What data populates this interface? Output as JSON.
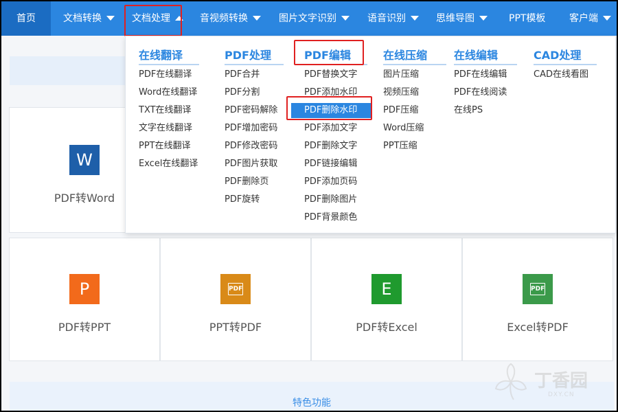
{
  "nav": {
    "items": [
      {
        "label": "首页"
      },
      {
        "label": "文档转换"
      },
      {
        "label": "文档处理"
      },
      {
        "label": "音视频转换"
      },
      {
        "label": "图片文字识别"
      },
      {
        "label": "语音识别"
      },
      {
        "label": "思维导图"
      },
      {
        "label": "PPT模板"
      },
      {
        "label": "客户端"
      }
    ]
  },
  "dropdown": {
    "columns": [
      {
        "title": "在线翻译",
        "items": [
          "PDF在线翻译",
          "Word在线翻译",
          "TXT在线翻译",
          "文字在线翻译",
          "PPT在线翻译",
          "Excel在线翻译"
        ]
      },
      {
        "title": "PDF处理",
        "items": [
          "PDF合并",
          "PDF分割",
          "PDF密码解除",
          "PDF增加密码",
          "PDF修改密码",
          "PDF图片获取",
          "PDF删除页",
          "PDF旋转"
        ]
      },
      {
        "title": "PDF编辑",
        "items": [
          "PDF替换文字",
          "PDF添加水印",
          "PDF删除水印",
          "PDF添加文字",
          "PDF删除文字",
          "PDF链接编辑",
          "PDF添加页码",
          "PDF删除图片",
          "PDF背景颜色"
        ]
      },
      {
        "title": "在线压缩",
        "items": [
          "图片压缩",
          "视频压缩",
          "PDF压缩",
          "Word压缩",
          "PPT压缩"
        ]
      },
      {
        "title": "在线编辑",
        "items": [
          "PDF在线编辑",
          "PDF在线阅读",
          "在线PS"
        ]
      },
      {
        "title": "CAD处理",
        "items": [
          "CAD在线看图"
        ]
      }
    ]
  },
  "cards": [
    {
      "label": "PDF转Word",
      "icon": "W",
      "icon_name": "word-icon",
      "color": "#1e5fa9"
    },
    {
      "label": "PDF转PPT",
      "icon": "P",
      "icon_name": "ppt-icon",
      "color": "#f26a1b"
    },
    {
      "label": "PPT转PDF",
      "icon": "PDF",
      "icon_name": "pdf-doc-icon",
      "color": "#d98a18"
    },
    {
      "label": "PDF转Excel",
      "icon": "E",
      "icon_name": "excel-icon",
      "color": "#1f9a2e"
    },
    {
      "label": "Excel转PDF",
      "icon": "PDF",
      "icon_name": "pdf-doc-icon",
      "color": "#3b9a4a"
    }
  ],
  "bottom": {
    "label": "特色功能"
  },
  "watermark": {
    "brand": "丁香园",
    "domain": "DXY.CN"
  },
  "colors": {
    "nav_bg": "#2b86e0",
    "nav_active": "#1b6cc2",
    "highlight": "#e02020",
    "accent": "#2b86e0"
  }
}
